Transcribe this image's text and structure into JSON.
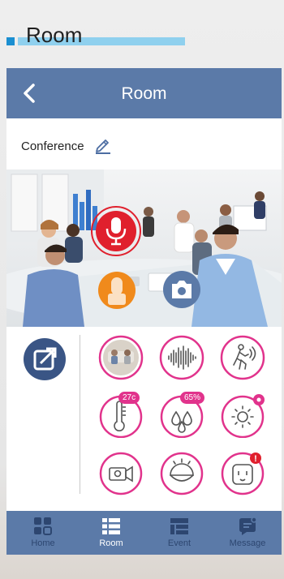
{
  "page_heading": "Room",
  "navbar": {
    "title": "Room",
    "back_icon": "chevron-left-icon"
  },
  "room": {
    "name": "Conference",
    "edit_icon": "pencil-icon"
  },
  "video": {
    "mic_icon": "microphone-icon",
    "talk_icon": "push-to-talk-icon",
    "camera_icon": "camera-icon"
  },
  "controls": {
    "share_icon": "share-out-icon",
    "items": [
      {
        "icon": "snapshot-thumbnail-icon"
      },
      {
        "icon": "sound-wave-icon"
      },
      {
        "icon": "motion-sensor-icon"
      },
      {
        "icon": "thermometer-icon",
        "badge": "27c"
      },
      {
        "icon": "humidity-icon",
        "badge": "65%"
      },
      {
        "icon": "brightness-icon",
        "badge_dot": true
      },
      {
        "icon": "video-record-icon"
      },
      {
        "icon": "night-light-icon"
      },
      {
        "icon": "smart-plug-icon",
        "alert": "!"
      }
    ]
  },
  "tabs": [
    {
      "label": "Home",
      "icon": "home-grid-icon",
      "active": false
    },
    {
      "label": "Room",
      "icon": "room-list-icon",
      "active": true
    },
    {
      "label": "Event",
      "icon": "event-list-icon",
      "active": false
    },
    {
      "label": "Message",
      "icon": "message-icon",
      "active": false
    }
  ],
  "colors": {
    "nav": "#5b7aa8",
    "accent_pink": "#e1338c",
    "mic_red": "#e0202d",
    "talk_orange": "#f08a1c",
    "heading_bar": "#8fd0ee"
  }
}
